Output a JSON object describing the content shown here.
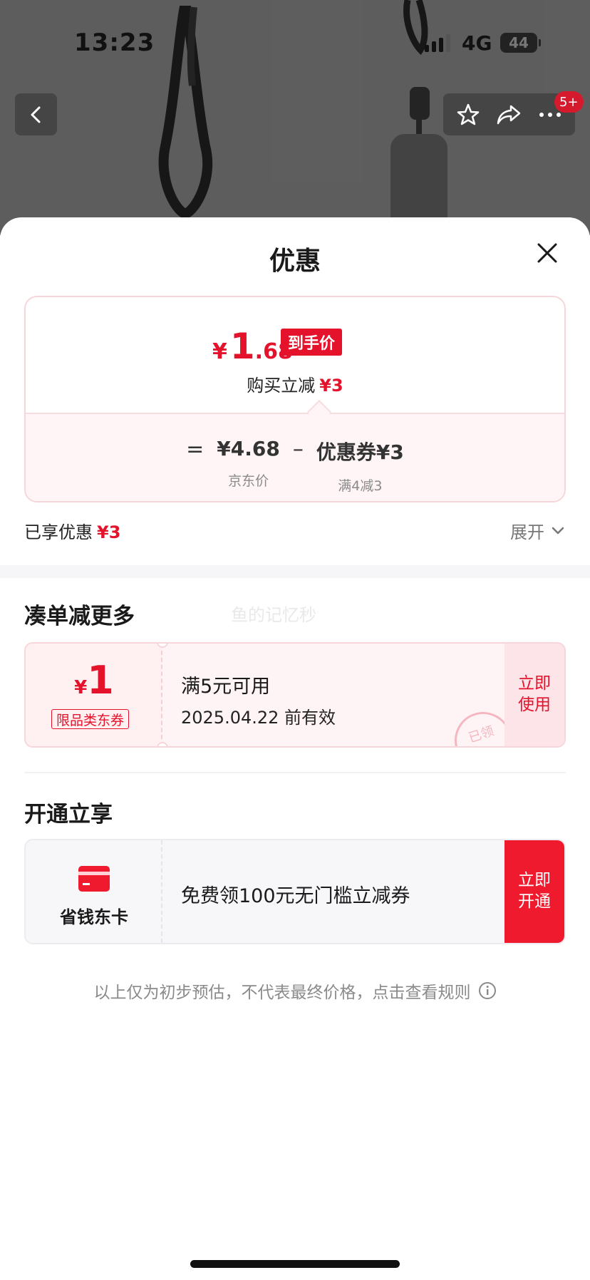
{
  "status_bar": {
    "time": "13:23",
    "network": "4G",
    "battery": "44"
  },
  "product_nav": {
    "back_icon": "chevron-left-icon",
    "favorite_icon": "star-icon",
    "share_icon": "share-icon",
    "more_icon": "more-dots-icon",
    "message_badge": "5+"
  },
  "sheet": {
    "title": "优惠",
    "close_icon": "close-icon"
  },
  "price_card": {
    "currency": "¥",
    "final_price_int": "1",
    "final_price_dec": ".68",
    "final_price_tag": "到手价",
    "instant_discount_label": "购买立减",
    "instant_discount_value": "¥3",
    "formula": {
      "equals": "=",
      "base_price": "¥4.68",
      "base_price_label": "京东价",
      "minus": "–",
      "coupon_value": "优惠券¥3",
      "coupon_condition": "满4减3"
    }
  },
  "enjoyed": {
    "label": "已享优惠",
    "value": "¥3"
  },
  "expand": {
    "label": "展开",
    "icon": "chevron-down-icon"
  },
  "more_section": {
    "title": "凑单减更多",
    "watermark": "鱼的记忆秒",
    "coupon": {
      "currency": "¥",
      "amount": "1",
      "category": "限品类东券",
      "condition": "满5元可用",
      "expiry": "2025.04.22 前有效",
      "action": "立即使用",
      "stamp": "已领"
    }
  },
  "member_section": {
    "title": "开通立享",
    "card_icon": "card-icon",
    "card_name": "省钱东卡",
    "description": "免费领100元无门槛立减券",
    "action": "立即开通"
  },
  "disclaimer": {
    "text": "以上仅为初步预估，不代表最终价格，点击查看规则",
    "icon": "info-icon"
  },
  "colors": {
    "accent_red": "#e4132b",
    "button_red": "#f01a2e",
    "pink_bg": "#fff4f5"
  }
}
